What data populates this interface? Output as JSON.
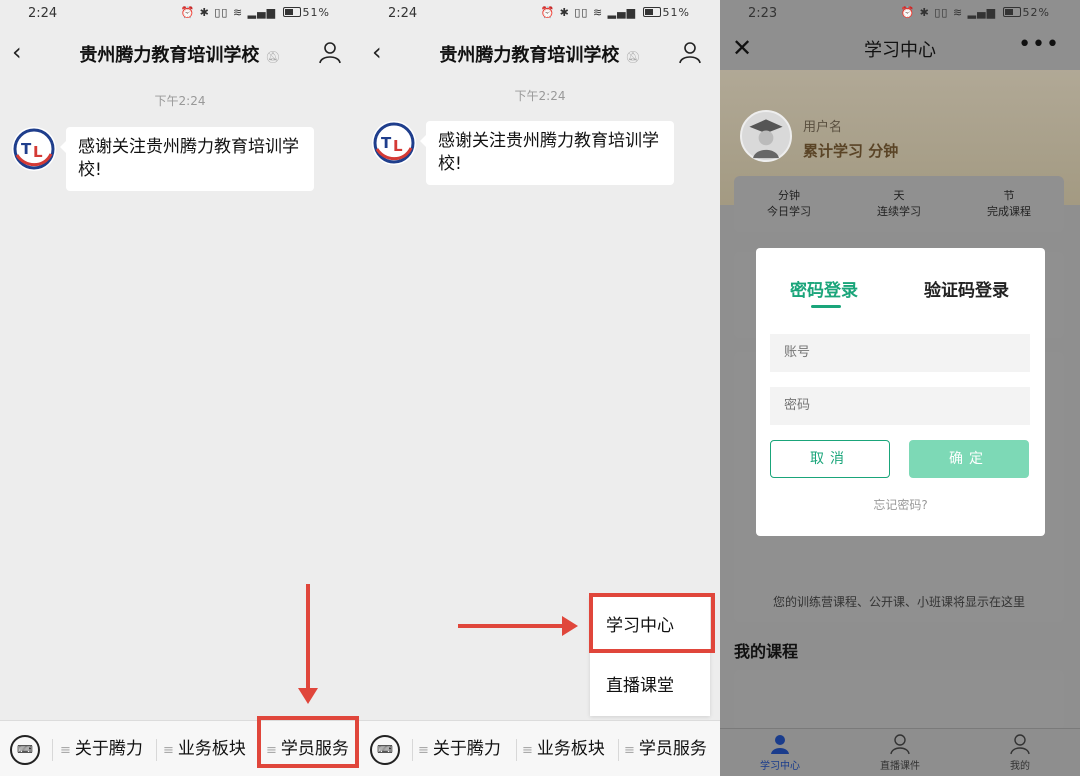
{
  "chat": {
    "title": "贵州腾力教育培训学校",
    "time_left": "2:24",
    "time_mid": "2:24",
    "battery_left": "51%",
    "battery_mid": "51%",
    "timestamp_left": "下午2:24",
    "timestamp_mid": "下午2:24",
    "message": "感谢关注贵州腾力教育培训学校!",
    "menu": [
      "关于腾力",
      "业务板块",
      "学员服务"
    ],
    "submenu": [
      "学习中心",
      "直播课堂"
    ]
  },
  "learning": {
    "time": "2:23",
    "battery": "52%",
    "title": "学习中心",
    "username": "用户名",
    "study_summary": "累计学习  分钟",
    "stats": [
      {
        "unit": "分钟",
        "label": "今日学习"
      },
      {
        "unit": "天",
        "label": "连续学习"
      },
      {
        "unit": "节",
        "label": "完成课程"
      }
    ],
    "empty_text": "您的训练营课程、公开课、小班课将显示在这里",
    "my_courses": "我的课程",
    "tabs": [
      "学习中心",
      "直播课件",
      "我的"
    ]
  },
  "login": {
    "tab_password": "密码登录",
    "tab_code": "验证码登录",
    "account_placeholder": "账号",
    "password_placeholder": "密码",
    "cancel": "取消",
    "confirm": "确定",
    "forgot": "忘记密码?"
  },
  "colors": {
    "highlight_red": "#e0463b",
    "accent_green": "#1aa57a",
    "confirm_green": "#7dd9b6"
  }
}
